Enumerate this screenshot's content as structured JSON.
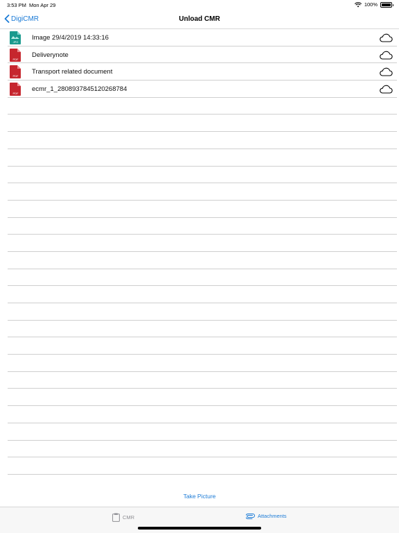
{
  "status_bar": {
    "time": "3:53 PM",
    "date": "Mon Apr 29",
    "battery": "100%"
  },
  "nav": {
    "back_label": "DigiCMR",
    "title": "Unload CMR"
  },
  "attachments": [
    {
      "type": "JPG",
      "name": "Image 29/4/2019 14:33:16"
    },
    {
      "type": "PDF",
      "name": "Deliverynote"
    },
    {
      "type": "PDF",
      "name": "Transport related document"
    },
    {
      "type": "PDF",
      "name": "ecmr_1_2808937845120268784"
    }
  ],
  "actions": {
    "take_picture": "Take Picture"
  },
  "tabs": {
    "cmr": "CMR",
    "attachments": "Attachments"
  },
  "colors": {
    "accent": "#1a7ad6",
    "pdf_icon": "#c6262e",
    "jpg_icon": "#1a9a8e",
    "inactive_tab": "#8e8e93"
  }
}
